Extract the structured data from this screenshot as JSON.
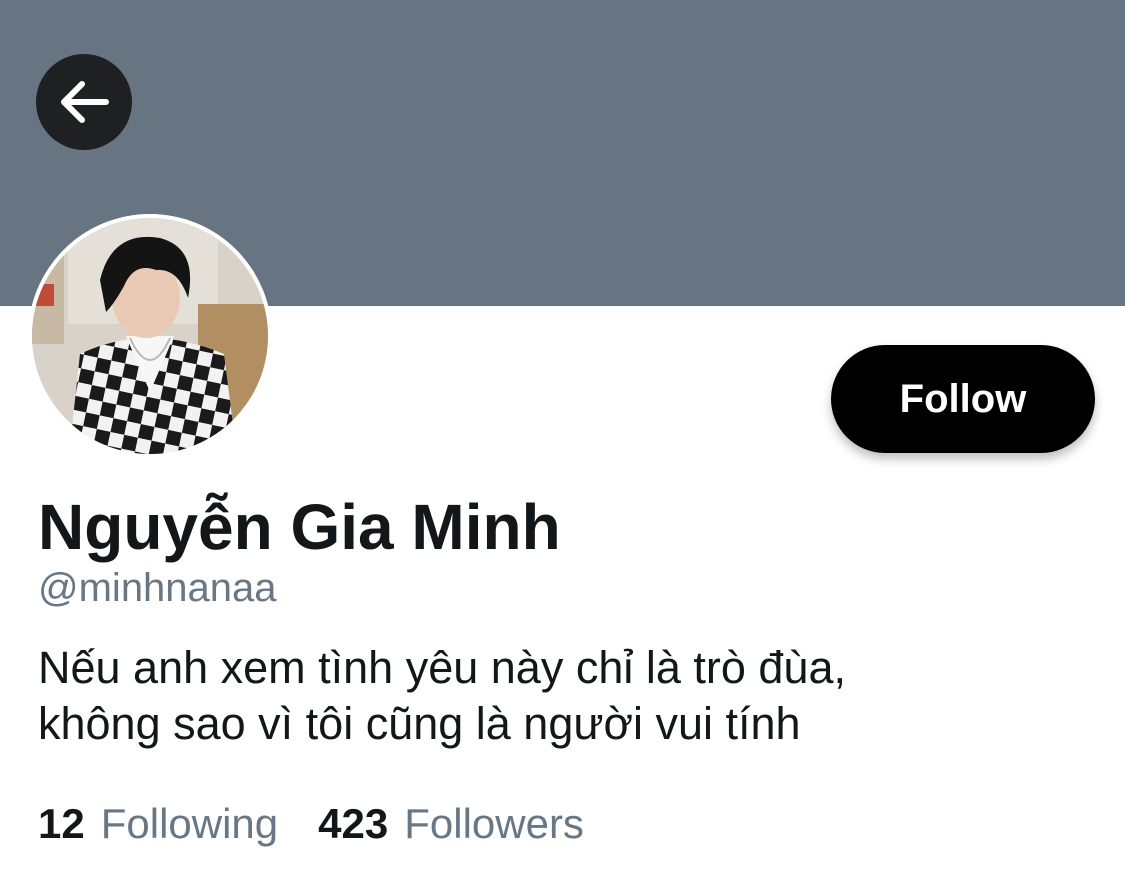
{
  "profile": {
    "display_name": "Nguyễn Gia Minh",
    "handle": "@minhnanaa",
    "bio_lines": [
      "Nếu anh xem tình yêu này chỉ là trò đùa,",
      "không sao vì tôi cũng là người vui tính"
    ],
    "follow_label": "Follow",
    "stats": {
      "following_count": "12",
      "following_label": "Following",
      "followers_count": "423",
      "followers_label": "Followers"
    }
  },
  "icons": {
    "back": "arrow-left-icon",
    "avatar": "profile-photo"
  },
  "colors": {
    "banner": "#677583",
    "back_button_bg": "#1f2022",
    "follow_button_bg": "#000000",
    "text_primary": "#14171a",
    "text_secondary": "#687785"
  }
}
